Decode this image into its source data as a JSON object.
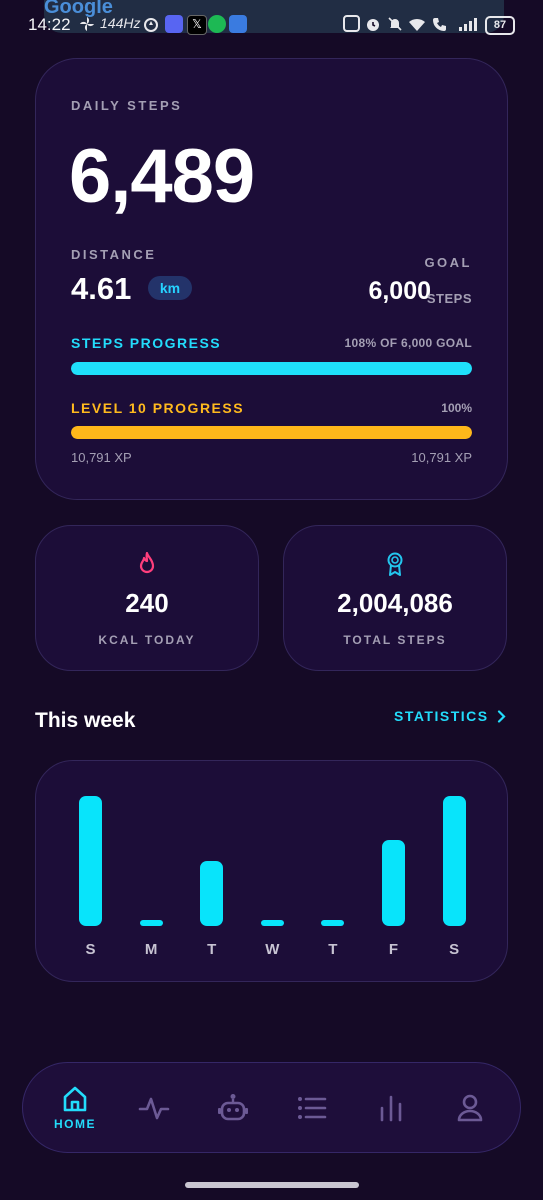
{
  "status_bar": {
    "time": "14:22",
    "google_text": "Google",
    "refresh_rate": "144Hz",
    "battery": "87",
    "icons": [
      "pinwheel-icon",
      "water-drop-icon",
      "discord-icon",
      "x-icon",
      "spotify-icon",
      "calendar-app-icon",
      "nfc-icon",
      "alarm-icon",
      "mute-icon",
      "wifi-icon",
      "wifi-call-icon",
      "signal-icon"
    ]
  },
  "steps_card": {
    "title": "DAILY STEPS",
    "steps": "6,489",
    "distance_label": "DISTANCE",
    "distance_value": "4.61",
    "distance_unit": "km",
    "goal_label": "GOAL",
    "goal_value": "6,000",
    "goal_unit": "STEPS",
    "steps_progress_label": "STEPS PROGRESS",
    "steps_progress_text": "108% OF 6,000 GOAL",
    "steps_progress_fraction": 1.0,
    "level_label": "LEVEL 10 PROGRESS",
    "level_percent_text": "100%",
    "level_progress_fraction": 1.0,
    "xp_left": "10,791 XP",
    "xp_right": "10,791 XP",
    "colors": {
      "steps_accent": "#1fe0fb",
      "level_accent": "#ffb71a"
    }
  },
  "stats": [
    {
      "icon": "flame-icon",
      "value": "240",
      "label": "KCAL TODAY",
      "color": "#ff3e7c"
    },
    {
      "icon": "award-ribbon-icon",
      "value": "2,004,086",
      "label": "TOTAL STEPS",
      "color": "#23c7ef"
    }
  ],
  "week": {
    "title": "This week",
    "statistics_link": "STATISTICS",
    "days": [
      "S",
      "M",
      "T",
      "W",
      "T",
      "F",
      "S"
    ]
  },
  "chart_data": {
    "type": "bar",
    "categories": [
      "S",
      "M",
      "T",
      "W",
      "T",
      "F",
      "S"
    ],
    "values": [
      1.0,
      0.04,
      0.5,
      0.04,
      0.04,
      0.66,
      1.0
    ],
    "title": "This week",
    "xlabel": "",
    "ylabel": "",
    "ylim": [
      0,
      1
    ],
    "color": "#08e4fb",
    "grid": false
  },
  "nav": {
    "items": [
      {
        "icon": "home-icon",
        "label": "HOME",
        "active": true
      },
      {
        "icon": "activity-icon",
        "label": "",
        "active": false
      },
      {
        "icon": "robot-icon",
        "label": "",
        "active": false
      },
      {
        "icon": "list-icon",
        "label": "",
        "active": false
      },
      {
        "icon": "bar-chart-icon",
        "label": "",
        "active": false
      },
      {
        "icon": "profile-icon",
        "label": "",
        "active": false
      }
    ]
  }
}
